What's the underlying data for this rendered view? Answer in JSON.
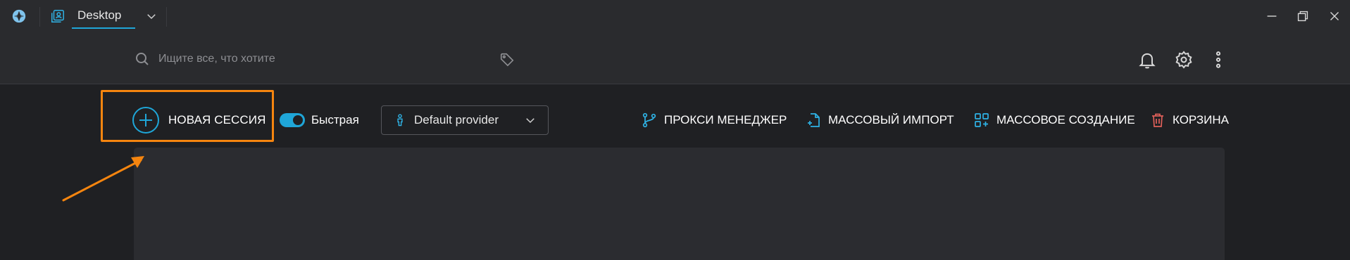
{
  "titlebar": {
    "workspace_label": "Desktop",
    "window_buttons": [
      "minimize-icon",
      "restore-icon",
      "close-icon"
    ]
  },
  "header": {
    "search": {
      "placeholder": "Ищите все, что хотите",
      "value": ""
    },
    "icons": [
      "bell-icon",
      "gear-icon",
      "kebab-menu-icon"
    ]
  },
  "toolbar": {
    "new_session_label": "НОВАЯ СЕССИЯ",
    "fast_toggle": {
      "label": "Быстрая",
      "on": true
    },
    "provider": {
      "selected": "Default provider"
    },
    "actions": {
      "proxy": "ПРОКСИ МЕНЕДЖЕР",
      "import": "МАССОВЫЙ ИМПОРТ",
      "bulk_create": "МАССОВОЕ СОЗДАНИЕ",
      "trash": "КОРЗИНА"
    }
  },
  "colors": {
    "accent": "#1fa6d8",
    "highlight": "#f5850f",
    "trash": "#e0605a",
    "background": "#1f2023",
    "bar": "#2a2b2e"
  }
}
